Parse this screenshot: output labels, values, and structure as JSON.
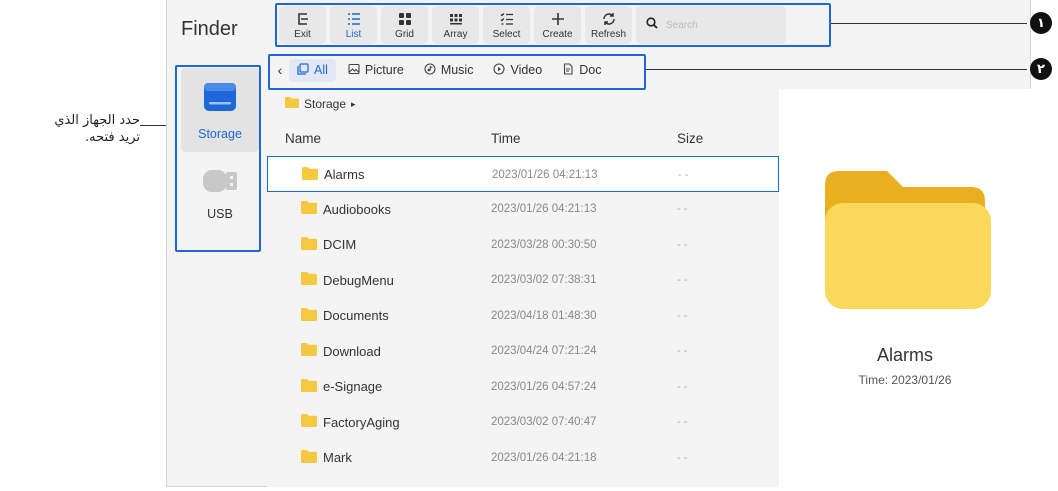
{
  "annotation": {
    "note_lines": [
      "حدد الجهاز الذي",
      "تريد فتحه."
    ],
    "badge_1": "١",
    "badge_2": "٢"
  },
  "app": {
    "title": "Finder"
  },
  "toolbar": {
    "buttons": [
      {
        "label": "Exit",
        "icon": "exit-icon"
      },
      {
        "label": "List",
        "icon": "list-icon",
        "active": true
      },
      {
        "label": "Grid",
        "icon": "grid-icon"
      },
      {
        "label": "Array",
        "icon": "array-icon"
      },
      {
        "label": "Select",
        "icon": "select-icon"
      },
      {
        "label": "Create",
        "icon": "plus-icon"
      },
      {
        "label": "Refresh",
        "icon": "refresh-icon"
      }
    ],
    "search_placeholder": "Search"
  },
  "sidebar": {
    "items": [
      {
        "label": "Storage",
        "icon": "storage-icon",
        "active": true
      },
      {
        "label": "USB",
        "icon": "usb-icon"
      }
    ]
  },
  "filters": {
    "tabs": [
      {
        "label": "All",
        "icon": "all-icon",
        "active": true
      },
      {
        "label": "Picture",
        "icon": "picture-icon"
      },
      {
        "label": "Music",
        "icon": "music-icon"
      },
      {
        "label": "Video",
        "icon": "video-icon"
      },
      {
        "label": "Doc",
        "icon": "doc-icon"
      }
    ]
  },
  "breadcrumb": {
    "label": "Storage",
    "arrow": "▸"
  },
  "table": {
    "headers": {
      "name": "Name",
      "time": "Time",
      "size": "Size"
    },
    "rows": [
      {
        "name": "Alarms",
        "time": "2023/01/26 04:21:13",
        "size": "- -",
        "selected": true
      },
      {
        "name": "Audiobooks",
        "time": "2023/01/26 04:21:13",
        "size": "- -"
      },
      {
        "name": "DCIM",
        "time": "2023/03/28 00:30:50",
        "size": "- -"
      },
      {
        "name": "DebugMenu",
        "time": "2023/03/02 07:38:31",
        "size": "- -"
      },
      {
        "name": "Documents",
        "time": "2023/04/18 01:48:30",
        "size": "- -"
      },
      {
        "name": "Download",
        "time": "2023/04/24 07:21:24",
        "size": "- -"
      },
      {
        "name": "e-Signage",
        "time": "2023/01/26 04:57:24",
        "size": "- -"
      },
      {
        "name": "FactoryAging",
        "time": "2023/03/02 07:40:47",
        "size": "- -"
      },
      {
        "name": "Mark",
        "time": "2023/01/26 04:21:18",
        "size": "- -"
      }
    ]
  },
  "preview": {
    "name": "Alarms",
    "time": "Time: 2023/01/26"
  },
  "colors": {
    "accent": "#1e67d8",
    "folder": "#f5c842",
    "folder_back": "#e8b021"
  }
}
